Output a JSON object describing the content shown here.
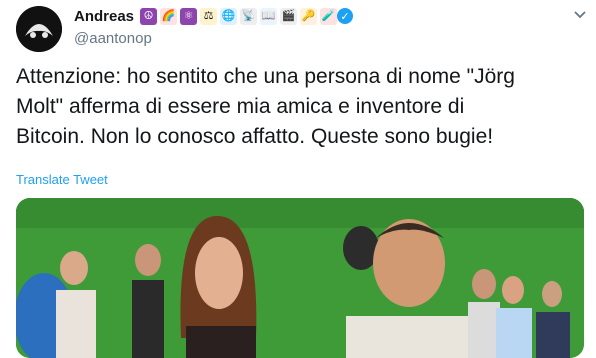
{
  "author": {
    "display_name": "Andreas",
    "handle": "@aantonop",
    "name_emojis": [
      "☮",
      "🌈",
      "⚛",
      "⚖",
      "🌐",
      "📡",
      "📖",
      "🎬",
      "🔑",
      "🧪"
    ]
  },
  "tweet": {
    "text": "Attenzione: ho sentito che una persona di nome \"Jörg\nMolt\" afferma di essere mia amica e inventore di\nBitcoin. Non lo conosco affatto. Queste sono bugie!",
    "translate_label": "Translate Tweet"
  },
  "colors": {
    "link": "#1da1f2",
    "secondary_text": "#657786",
    "photo_wall": "#3f9a38"
  },
  "icons": {
    "menu": "chevron-down-icon",
    "verified": "verified-badge-icon"
  }
}
